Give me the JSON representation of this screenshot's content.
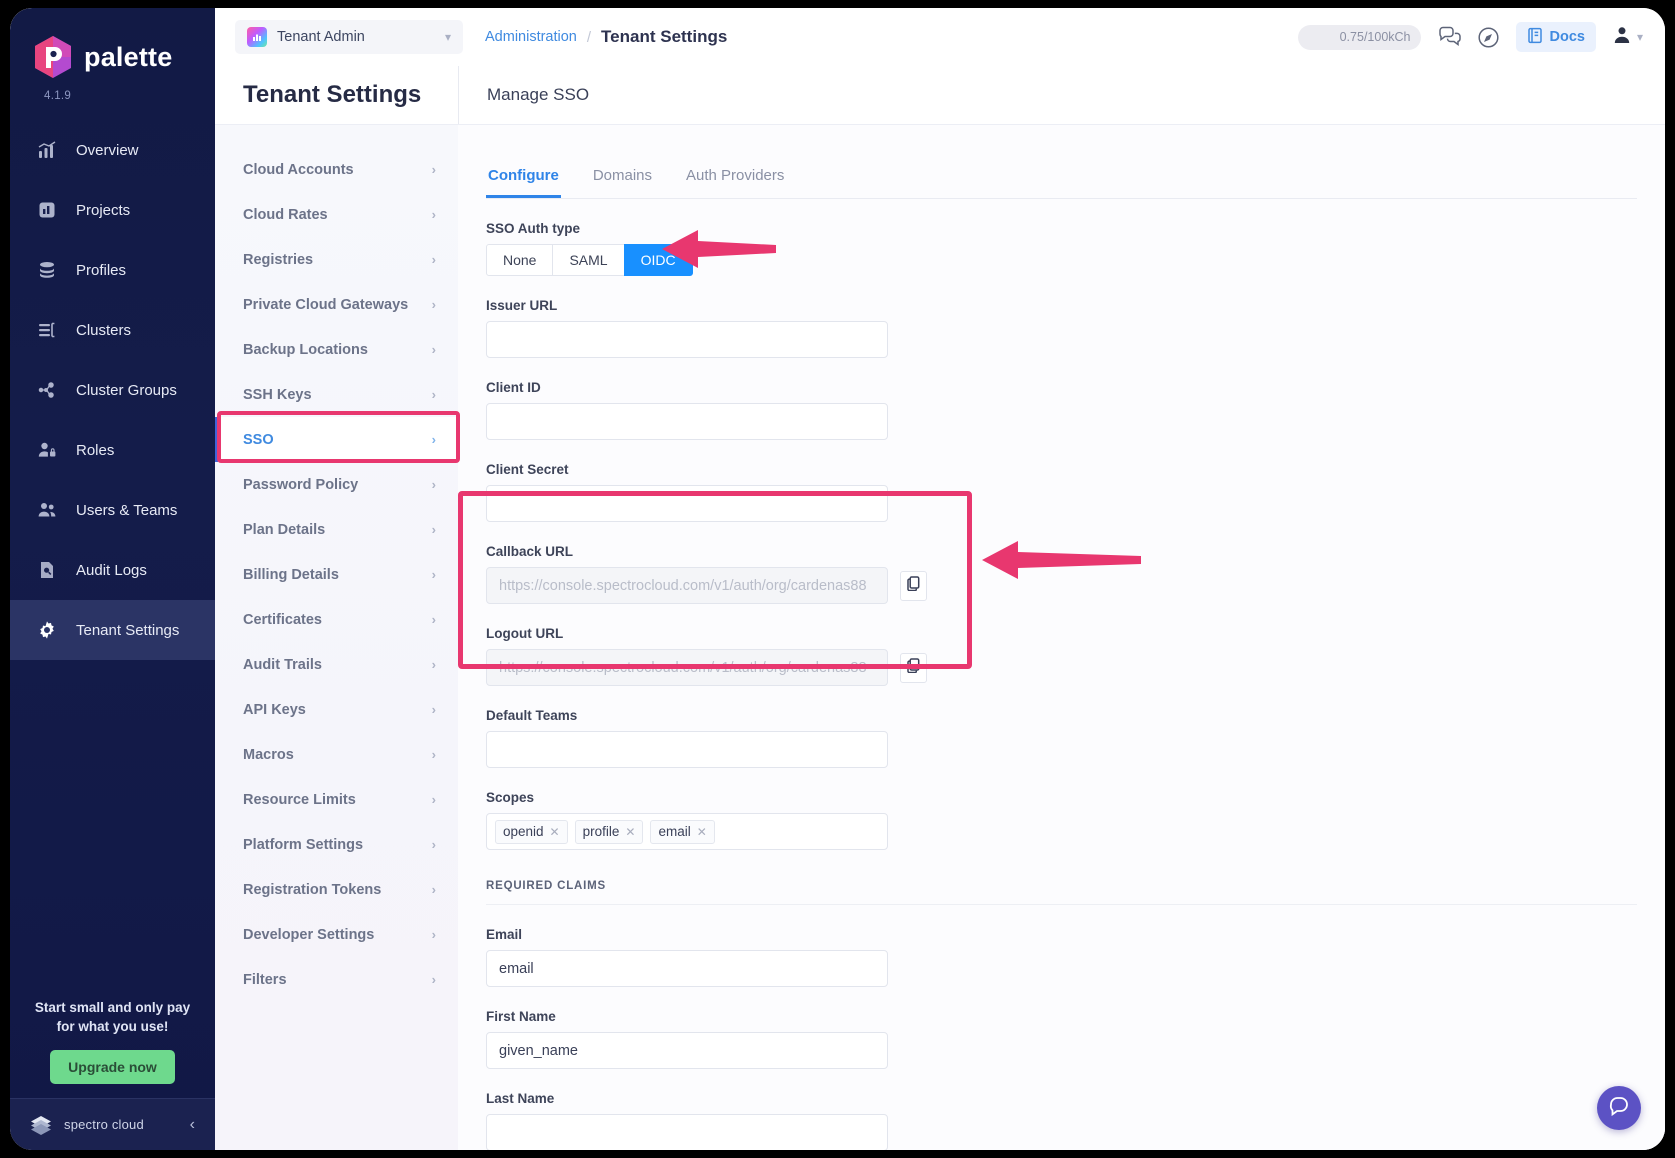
{
  "brand": {
    "name": "palette",
    "version": "4.1.9"
  },
  "sidebar": {
    "items": [
      {
        "label": "Overview",
        "icon": "chart-overview-icon"
      },
      {
        "label": "Projects",
        "icon": "projects-icon"
      },
      {
        "label": "Profiles",
        "icon": "profiles-stack-icon"
      },
      {
        "label": "Clusters",
        "icon": "clusters-icon"
      },
      {
        "label": "Cluster Groups",
        "icon": "cluster-groups-icon"
      },
      {
        "label": "Roles",
        "icon": "roles-icon"
      },
      {
        "label": "Users & Teams",
        "icon": "users-teams-icon"
      },
      {
        "label": "Audit Logs",
        "icon": "audit-logs-icon"
      },
      {
        "label": "Tenant Settings",
        "icon": "gear-icon"
      }
    ],
    "active_item": "Tenant Settings",
    "upsell": {
      "line1": "Start small and only pay",
      "line2": "for what you use!",
      "cta": "Upgrade now"
    },
    "footer": {
      "company": "spectro cloud",
      "collapse_icon": "chevron-left-icon"
    }
  },
  "topbar": {
    "tenant_selector": {
      "value": "Tenant Admin",
      "chevron": "chevron-down-icon"
    },
    "breadcrumb": {
      "parent": "Administration",
      "separator": "/",
      "current": "Tenant Settings"
    },
    "usage_pill": "0.75/100kCh",
    "chat_icon": "chat-bubbles-icon",
    "compass_icon": "compass-icon",
    "docs": {
      "label": "Docs",
      "icon": "book-icon"
    },
    "user": {
      "icon": "user-avatar-icon",
      "chevron": "chevron-down-icon"
    }
  },
  "subnav": {
    "title": "Tenant Settings",
    "selected": "SSO",
    "items": [
      "Cloud Accounts",
      "Cloud Rates",
      "Registries",
      "Private Cloud Gateways",
      "Backup Locations",
      "SSH Keys",
      "SSO",
      "Password Policy",
      "Plan Details",
      "Billing Details",
      "Certificates",
      "Audit Trails",
      "API Keys",
      "Macros",
      "Resource Limits",
      "Platform Settings",
      "Registration Tokens",
      "Developer Settings",
      "Filters"
    ]
  },
  "main": {
    "header_title": "Manage SSO",
    "tabs": [
      {
        "label": "Configure",
        "active": true
      },
      {
        "label": "Domains",
        "active": false
      },
      {
        "label": "Auth Providers",
        "active": false
      }
    ],
    "auth_type": {
      "label": "SSO Auth type",
      "options": [
        "None",
        "SAML",
        "OIDC"
      ],
      "selected": "OIDC"
    },
    "fields": [
      {
        "label": "Issuer URL",
        "value": "",
        "placeholder": ""
      },
      {
        "label": "Client ID",
        "value": "",
        "placeholder": ""
      },
      {
        "label": "Client Secret",
        "value": "",
        "placeholder": ""
      }
    ],
    "callback": {
      "label": "Callback URL",
      "placeholder": "https://console.spectrocloud.com/v1/auth/org/cardenas88",
      "copy_icon": "copy-icon"
    },
    "logout": {
      "label": "Logout URL",
      "placeholder": "https://console.spectrocloud.com/v1/auth/org/cardenas88",
      "copy_icon": "copy-icon"
    },
    "default_teams": {
      "label": "Default Teams",
      "value": ""
    },
    "scopes": {
      "label": "Scopes",
      "chips": [
        "openid",
        "profile",
        "email"
      ],
      "remove_icon": "close-icon"
    },
    "required_claims": {
      "title": "REQUIRED CLAIMS",
      "fields": [
        {
          "label": "Email",
          "value": "email"
        },
        {
          "label": "First Name",
          "value": "given_name"
        },
        {
          "label": "Last Name",
          "value": ""
        }
      ]
    },
    "help_fab": "help-bubble-icon"
  },
  "colors": {
    "accent_blue": "#1890ff",
    "highlight_pink": "#e8376f",
    "sidebar_navy": "#141c4a",
    "upgrade_green": "#6ed98d"
  }
}
